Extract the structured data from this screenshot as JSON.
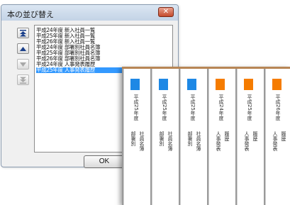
{
  "dialog": {
    "title": "本の並び替え",
    "close_label": "✕",
    "ok_label": "OK",
    "items": [
      {
        "label": "平成24年度 新入社員一覧"
      },
      {
        "label": "平成25年度 新入社員一覧"
      },
      {
        "label": "平成26年度 新入社員一覧"
      },
      {
        "label": "平成24年度 部署別社員名簿"
      },
      {
        "label": "平成25年度 部署別社員名簿"
      },
      {
        "label": "平成26年度 部署別社員名簿"
      },
      {
        "label": "平成24年度 人事発表履歴"
      },
      {
        "label": "平成25年度 人事発表履歴"
      }
    ],
    "selected_index": 7,
    "move_buttons": [
      {
        "icon": "move-to-top-icon",
        "enabled": true
      },
      {
        "icon": "move-up-icon",
        "enabled": true
      },
      {
        "icon": "move-down-icon",
        "enabled": false
      },
      {
        "icon": "move-to-bottom-icon",
        "enabled": false
      }
    ]
  },
  "binders": [
    {
      "tab_color": "#1e88e5",
      "year": "平成25年度",
      "category": "部署別",
      "title": "社員名簿"
    },
    {
      "tab_color": "#1e88e5",
      "year": "平成25年度",
      "category": "部署別",
      "title": "社員名簿"
    },
    {
      "tab_color": "#1e88e5",
      "year": "平成25年度",
      "category": "部署別",
      "title": "社員名簿"
    },
    {
      "tab_color": "#f57c00",
      "year": "平成24年度",
      "category": "人事発表",
      "title": "履歴"
    },
    {
      "tab_color": "#f57c00",
      "year": "平成25年度",
      "category": "人事発表",
      "title": "履歴"
    },
    {
      "tab_color": "#f57c00",
      "year": "平成26年度",
      "category": "人事発表",
      "title": "履歴"
    }
  ]
}
